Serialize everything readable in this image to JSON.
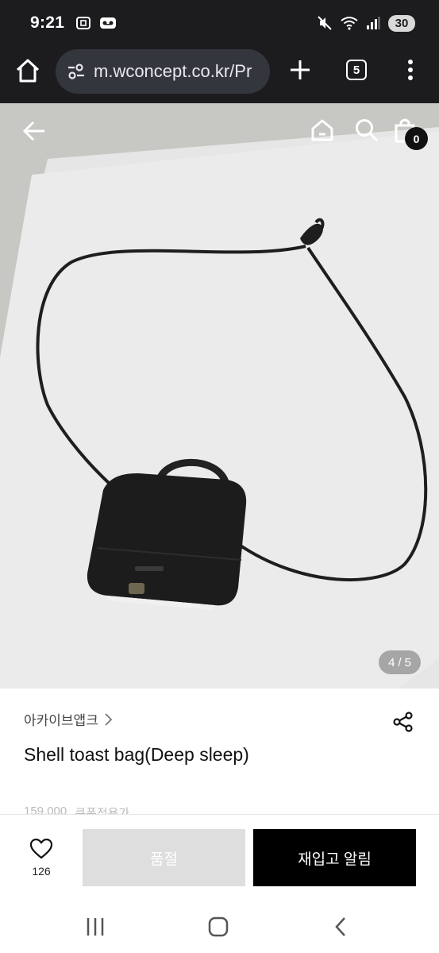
{
  "status_bar": {
    "time": "9:21",
    "left_icons": [
      "screenshot-icon",
      "voicemail-icon"
    ],
    "right_icons": [
      "mute-icon",
      "wifi-icon",
      "signal-icon"
    ],
    "battery": "30"
  },
  "browser": {
    "url": "m.wconcept.co.kr/Pr",
    "tab_count": "5",
    "icons": [
      "home-icon",
      "site-settings-icon",
      "new-tab-icon",
      "more-icon"
    ]
  },
  "product_header": {
    "icons": [
      "back-arrow-icon",
      "home-icon",
      "search-icon",
      "shopping-bag-icon"
    ],
    "cart_count": "0"
  },
  "gallery": {
    "current": "4",
    "separator": "/",
    "total": "5"
  },
  "product": {
    "brand": "아카이브앱크",
    "name": "Shell toast bag(Deep sleep)",
    "original_price": "159,000",
    "price_label": "쿠폰적용가"
  },
  "actions": {
    "like_count": "126",
    "soldout_label": "품절",
    "restock_label": "재입고 알림"
  },
  "system_nav": {
    "icons": [
      "recent-apps-icon",
      "home-button-icon",
      "back-icon"
    ]
  },
  "colors": {
    "top_bar": "#1c1c1f",
    "url_pill": "#34363e",
    "soldout_bg": "#dedede",
    "restock_bg": "#000000"
  }
}
